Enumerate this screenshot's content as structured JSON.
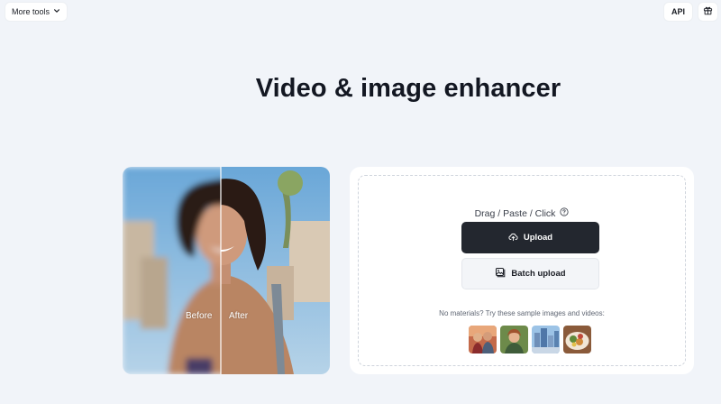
{
  "header": {
    "more_tools_label": "More tools",
    "api_label": "API",
    "icons": [
      "chevron-down-icon",
      "gift-icon"
    ]
  },
  "main": {
    "title": "Video & image enhancer"
  },
  "demo": {
    "before_label": "Before",
    "after_label": "After"
  },
  "upload": {
    "drag_text": "Drag / Paste / Click",
    "upload_label": "Upload",
    "batch_label": "Batch upload",
    "samples_text": "No materials? Try these sample images and videos:",
    "icons": [
      "help-icon",
      "cloud-upload-icon",
      "batch-image-icon"
    ]
  },
  "colors": {
    "background": "#f1f4f9",
    "primary_button": "#23272f",
    "card": "#ffffff"
  }
}
